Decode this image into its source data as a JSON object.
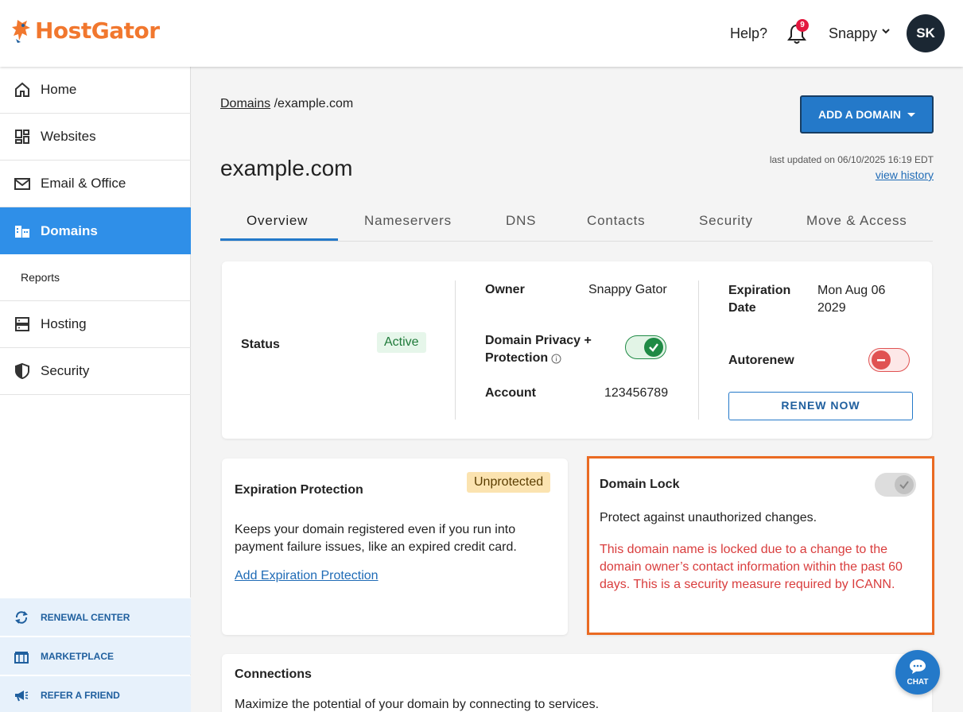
{
  "header": {
    "logo_text": "HostGator",
    "help_label": "Help?",
    "notification_count": "9",
    "user_name": "Snappy",
    "avatar_initials": "SK"
  },
  "sidebar": {
    "items": [
      {
        "label": "Home",
        "icon": "home-icon"
      },
      {
        "label": "Websites",
        "icon": "websites-icon"
      },
      {
        "label": "Email & Office",
        "icon": "mail-icon"
      },
      {
        "label": "Domains",
        "icon": "domains-icon",
        "active": true
      },
      {
        "label": "Reports"
      },
      {
        "label": "Hosting",
        "icon": "server-icon"
      },
      {
        "label": "Security",
        "icon": "shield-icon"
      }
    ],
    "bottom": [
      {
        "label": "RENEWAL CENTER",
        "icon": "renew-icon"
      },
      {
        "label": "MARKETPLACE",
        "icon": "marketplace-icon"
      },
      {
        "label": "REFER A FRIEND",
        "icon": "megaphone-icon"
      }
    ]
  },
  "breadcrumb": {
    "link": "Domains",
    "separator": "/",
    "current": "example.com"
  },
  "add_domain_label": "ADD A DOMAIN",
  "page_title": "example.com",
  "last_updated": "last updated on 06/10/2025 16:19 EDT",
  "view_history": "view history",
  "tabs": [
    "Overview",
    "Nameservers",
    "DNS",
    "Contacts",
    "Security",
    "Move & Access"
  ],
  "overview": {
    "status_label": "Status",
    "status_value": "Active",
    "owner_label": "Owner",
    "owner_value": "Snappy Gator",
    "privacy_label_line1": "Domain Privacy +",
    "privacy_label_line2": "Protection",
    "privacy_enabled": true,
    "account_label": "Account",
    "account_value": "123456789",
    "expiration_label_line1": "Expiration",
    "expiration_label_line2": "Date",
    "expiration_value_line1": "Mon Aug 06",
    "expiration_value_line2": "2029",
    "autorenew_label": "Autorenew",
    "autorenew_enabled": false,
    "renew_button": "RENEW NOW"
  },
  "expiration_protection": {
    "title": "Expiration Protection",
    "badge": "Unprotected",
    "description": "Keeps your domain registered even if you run into payment failure issues, like an expired credit card.",
    "link": "Add Expiration Protection"
  },
  "domain_lock": {
    "title": "Domain Lock",
    "enabled": true,
    "description": "Protect against unauthorized changes.",
    "warning": "This domain name is locked due to a change to the domain owner’s contact information within the past 60 days. This is a security measure required by ICANN."
  },
  "connections": {
    "title": "Connections",
    "description": "Maximize the potential of your domain by connecting to services."
  },
  "chat_label": "CHAT",
  "colors": {
    "brand_orange": "#f1772e",
    "primary_blue": "#2479c9",
    "active_nav": "#2f8fe8",
    "success_green": "#1f8a45",
    "danger_red": "#d93d3d",
    "highlight_border": "#ea6a22"
  }
}
